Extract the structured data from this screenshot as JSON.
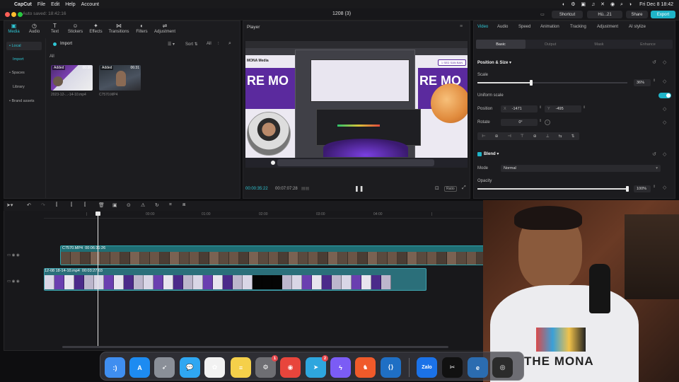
{
  "menubar": {
    "app_name": "CapCut",
    "items": [
      "File",
      "Edit",
      "Help",
      "Account"
    ],
    "clock": "Fri Dec 8  18:42"
  },
  "titlebar": {
    "autosave": "Auto saved: 18:42:16",
    "document": "1208 (3)",
    "shortcut_label": "Shortcut",
    "user_label": "Hù...21",
    "share_label": "Share",
    "export_label": "Export"
  },
  "media": {
    "tabs": [
      {
        "label": "Media",
        "icon": "media-icon",
        "glyph": "▣"
      },
      {
        "label": "Audio",
        "icon": "audio-icon",
        "glyph": "◷"
      },
      {
        "label": "Text",
        "icon": "text-icon",
        "glyph": "T"
      },
      {
        "label": "Stickers",
        "icon": "stickers-icon",
        "glyph": "☺"
      },
      {
        "label": "Effects",
        "icon": "effects-icon",
        "glyph": "✦"
      },
      {
        "label": "Transitions",
        "icon": "transitions-icon",
        "glyph": "⋈"
      },
      {
        "label": "Filters",
        "icon": "filters-icon",
        "glyph": "◐"
      },
      {
        "label": "Adjustment",
        "icon": "adjustment-icon",
        "glyph": "⇌"
      }
    ],
    "sidebar": [
      "• Local",
      "Import",
      "• Spaces",
      "Library",
      "• Brand assets"
    ],
    "import_label": "Import",
    "sort_label": "Sort",
    "all_filter_label": "All",
    "section_all": "All",
    "clips": [
      {
        "badge": "Added",
        "duration": "00:30",
        "name": "2023-12-...-14-10.mp4"
      },
      {
        "badge": "Added",
        "duration": "06:31",
        "name": "C7570.MP4"
      }
    ]
  },
  "player": {
    "title": "Player",
    "current_time": "00:00:35:22",
    "total_time": "00:07:07:28",
    "ratio_label": "Ratio",
    "preview": {
      "banner_text": "RE MO",
      "brand": "MONA Media",
      "button_text": "1 SED SAN BAN"
    }
  },
  "inspector": {
    "tabs": [
      "Video",
      "Audio",
      "Speed",
      "Animation",
      "Tracking",
      "Adjustment",
      "AI stylize"
    ],
    "subtabs": [
      "Basic",
      "Output",
      "Mask",
      "Enhance"
    ],
    "position_size": "Position & Size",
    "scale_label": "Scale",
    "scale_value": "36%",
    "scale_level": 0.36,
    "uniform_scale_label": "Uniform scale",
    "uniform_scale_on": true,
    "position_label": "Position",
    "pos_x_label": "X",
    "pos_x": "-1471",
    "pos_y_label": "Y",
    "pos_y": "-495",
    "rotate_label": "Rotate",
    "rotate_value": "0°",
    "blend_label": "Blend",
    "mode_label": "Mode",
    "mode_value": "Normal",
    "opacity_label": "Opacity",
    "opacity_value": "100%",
    "opacity_level": 1.0
  },
  "timeline": {
    "ruler_labels": [
      "00:00",
      "01:00",
      "02:00",
      "03:00",
      "04:00"
    ],
    "track1": {
      "clip_name": "C7570.MP4",
      "clip_duration": "00:06:31:26"
    },
    "track2": {
      "clip_name": "12-08 18-14-10.mp4",
      "clip_duration": "00:03:27:03"
    }
  },
  "overlay": {
    "shirt_text": "THE MONA"
  },
  "dock": {
    "apps": [
      {
        "icon": "finder-icon",
        "color": "#3f8ef0",
        "glyph": ":)",
        "badge": ""
      },
      {
        "icon": "app-store-icon",
        "color": "#1d8bf1",
        "glyph": "A",
        "badge": ""
      },
      {
        "icon": "launchpad-icon",
        "color": "#8a8f98",
        "glyph": "➶",
        "badge": ""
      },
      {
        "icon": "messages-icon",
        "color": "#2fa7f2",
        "glyph": "💬",
        "badge": ""
      },
      {
        "icon": "photos-icon",
        "color": "#f2f2f2",
        "glyph": "✿",
        "badge": ""
      },
      {
        "icon": "notes-icon",
        "color": "#f5d04a",
        "glyph": "≡",
        "badge": ""
      },
      {
        "icon": "settings-icon",
        "color": "#6e6e73",
        "glyph": "⚙",
        "badge": "1"
      },
      {
        "icon": "chrome-icon",
        "color": "#e8453c",
        "glyph": "◉",
        "badge": ""
      },
      {
        "icon": "telegram-icon",
        "color": "#2ea6de",
        "glyph": "➤",
        "badge": "2"
      },
      {
        "icon": "messenger-icon",
        "color": "#7b5cf5",
        "glyph": "ϟ",
        "badge": ""
      },
      {
        "icon": "brave-icon",
        "color": "#f05a2a",
        "glyph": "♞",
        "badge": ""
      },
      {
        "icon": "vscode-icon",
        "color": "#1f6fc4",
        "glyph": "⟨⟩",
        "badge": ""
      },
      {
        "icon": "zalo-icon",
        "color": "#1b72e8",
        "glyph": "Zalo",
        "badge": ""
      },
      {
        "icon": "capcut-icon",
        "color": "#111111",
        "glyph": "✂",
        "badge": ""
      },
      {
        "icon": "edge-icon",
        "color": "#2b6cb0",
        "glyph": "e",
        "badge": ""
      },
      {
        "icon": "obs-icon",
        "color": "#2b2b2b",
        "glyph": "◎",
        "badge": ""
      }
    ]
  },
  "colors": {
    "accent": "#2fc6d4",
    "export": "#1fb4c8",
    "panel": "#1c1c1f",
    "clip1": "#1f6e74",
    "clip2": "#2b6f7a"
  }
}
